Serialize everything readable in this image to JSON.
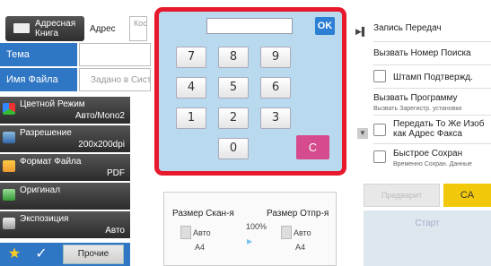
{
  "header": {
    "address_book": "Адресная Книга",
    "address_label": "Адрес",
    "address_field": "Кося Адре"
  },
  "fields": {
    "subject_label": "Тема",
    "file_name_label": "Имя Файла",
    "file_name_placeholder": "Задано в Систе"
  },
  "modes": [
    {
      "title": "Цветной Режим",
      "value": "Авто/Mono2",
      "icon": "color-mode-icon"
    },
    {
      "title": "Разрешение",
      "value": "200x200dpi",
      "icon": "resolution-icon"
    },
    {
      "title": "Формат Файла",
      "value": "PDF",
      "icon": "file-format-icon"
    },
    {
      "title": "Оригинал",
      "value": "",
      "icon": "original-icon"
    },
    {
      "title": "Экспозиция",
      "value": "Авто",
      "icon": "exposure-icon"
    }
  ],
  "bottom": {
    "program_label": "Прочие"
  },
  "keypad": {
    "display_value": "",
    "ok_label": "OK",
    "keys": [
      "7",
      "8",
      "9",
      "4",
      "5",
      "6",
      "1",
      "2",
      "3",
      "0"
    ],
    "clear_label": "C"
  },
  "size": {
    "scan_label": "Размер Скан-я",
    "send_label": "Размер Отпр-я",
    "percent": "100%",
    "scan_mode": "Авто",
    "scan_paper": "A4",
    "send_mode": "Авто",
    "send_paper": "A4"
  },
  "right_panel": {
    "record": "Запись Передач",
    "call_search": "Вызвать Номер Поиска",
    "stamp": "Штамп Подтвержд.",
    "call_program": "Вызвать Программу",
    "call_program_sub": "Вызвать Зарегистр. установки",
    "forward": "Передать То Же Изоб как Адрес Факса",
    "quick_save": "Быстрое Сохран",
    "quick_save_sub": "Временно Сохран. Данные"
  },
  "actions": {
    "preview": "Предварит",
    "ca": "CA",
    "start": "Старт"
  },
  "colors": {
    "accent_blue": "#2f76c4",
    "highlight_red": "#e8192d",
    "clear_pink": "#d54b8d",
    "ca_yellow": "#f1c90a"
  }
}
